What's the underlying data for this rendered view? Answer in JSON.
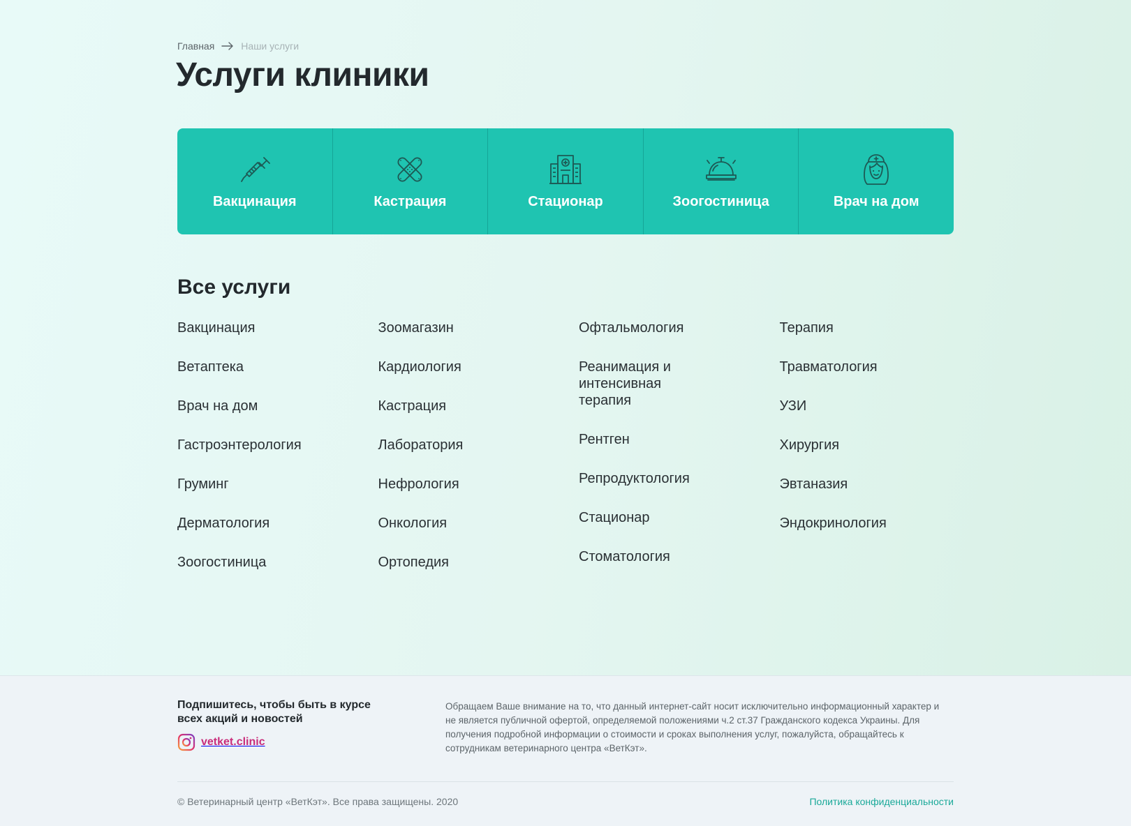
{
  "breadcrumb": {
    "home": "Главная",
    "current": "Наши услуги"
  },
  "page_title": "Услуги клиники",
  "featured": [
    {
      "label": "Вакцинация",
      "icon": "syringe-icon"
    },
    {
      "label": "Кастрация",
      "icon": "bandage-icon"
    },
    {
      "label": "Стационар",
      "icon": "hospital-icon"
    },
    {
      "label": "Зоогостиница",
      "icon": "hotel-bell-icon"
    },
    {
      "label": "Врач на дом",
      "icon": "nurse-icon"
    }
  ],
  "all_services_title": "Все услуги",
  "services": {
    "col1": [
      "Вакцинация",
      "Ветаптека",
      "Врач на дом",
      "Гастроэнтерология",
      "Груминг",
      "Дерматология",
      "Зоогостиница"
    ],
    "col2": [
      "Зоомагазин",
      "Кардиология",
      "Кастрация",
      "Лаборатория",
      "Нефрология",
      "Онкология",
      "Ортопедия"
    ],
    "col3": [
      "Офтальмология",
      "Реанимация и интенсивная терапия",
      "Рентген",
      "Репродуктология",
      "Стационар",
      "Стоматология"
    ],
    "col4": [
      "Терапия",
      "Травматология",
      "УЗИ",
      "Хирургия",
      "Эвтаназия",
      "Эндокринология"
    ]
  },
  "footer": {
    "subscribe_title": "Подпишитесь, чтобы быть в курсе всех акций и новостей",
    "instagram_handle": "vetket.clinic",
    "disclaimer": "Обращаем Ваше внимание на то, что данный интернет-сайт носит исключительно информационный характер и не является публичной офертой, определяемой положениями ч.2 ст.37 Гражданского кодекса Украины. Для получения подробной информации о стоимости и сроках выполнения услуг, пожалуйста, обращайтесь к сотрудникам ветеринарного центра «ВетКэт».",
    "copyright": "© Ветеринарный центр «ВетКэт». Все права защищены. 2020",
    "privacy": "Политика конфиденциальности"
  },
  "colors": {
    "accent": "#1fc4b1",
    "icon_stroke": "#1d5a55",
    "link": "#1aa999",
    "text": "#23292d"
  }
}
